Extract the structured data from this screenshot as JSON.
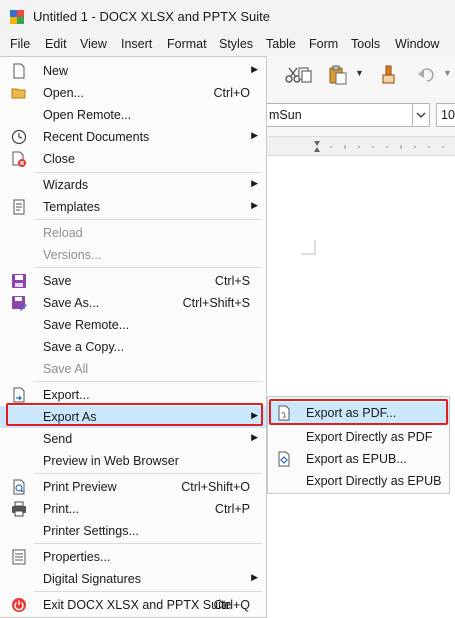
{
  "window": {
    "title": "Untitled 1 - DOCX XLSX and PPTX Suite"
  },
  "menubar": {
    "items": [
      "File",
      "Edit",
      "View",
      "Insert",
      "Format",
      "Styles",
      "Table",
      "Form",
      "Tools",
      "Window"
    ]
  },
  "toolbar": {
    "font_name": "mSun",
    "font_size": "10"
  },
  "file_menu": {
    "items": [
      {
        "label": "New",
        "shortcut": "",
        "submenu": true,
        "icon": "new-document-icon"
      },
      {
        "label": "Open...",
        "shortcut": "Ctrl+O",
        "icon": "folder-open-icon"
      },
      {
        "label": "Open Remote...",
        "shortcut": ""
      },
      {
        "label": "Recent Documents",
        "shortcut": "",
        "submenu": true,
        "icon": "recent-clock-icon"
      },
      {
        "label": "Close",
        "shortcut": "",
        "icon": "close-document-icon"
      },
      {
        "label": "Wizards",
        "shortcut": "",
        "submenu": true
      },
      {
        "label": "Templates",
        "shortcut": "",
        "submenu": true,
        "icon": "templates-icon"
      },
      {
        "label": "Reload",
        "shortcut": "",
        "disabled": true
      },
      {
        "label": "Versions...",
        "shortcut": "",
        "disabled": true
      },
      {
        "label": "Save",
        "shortcut": "Ctrl+S",
        "icon": "save-icon"
      },
      {
        "label": "Save As...",
        "shortcut": "Ctrl+Shift+S",
        "icon": "save-as-icon"
      },
      {
        "label": "Save Remote...",
        "shortcut": ""
      },
      {
        "label": "Save a Copy...",
        "shortcut": ""
      },
      {
        "label": "Save All",
        "shortcut": "",
        "disabled": true
      },
      {
        "label": "Export...",
        "shortcut": "",
        "icon": "export-icon"
      },
      {
        "label": "Export As",
        "shortcut": "",
        "submenu": true,
        "active": true
      },
      {
        "label": "Send",
        "shortcut": "",
        "submenu": true
      },
      {
        "label": "Preview in Web Browser",
        "shortcut": ""
      },
      {
        "label": "Print Preview",
        "shortcut": "Ctrl+Shift+O",
        "icon": "print-preview-icon"
      },
      {
        "label": "Print...",
        "shortcut": "Ctrl+P",
        "icon": "printer-icon"
      },
      {
        "label": "Printer Settings...",
        "shortcut": ""
      },
      {
        "label": "Properties...",
        "shortcut": "",
        "icon": "properties-icon"
      },
      {
        "label": "Digital Signatures",
        "shortcut": "",
        "submenu": true
      },
      {
        "label": "Exit DOCX XLSX and PPTX Suite",
        "shortcut": "Ctrl+Q",
        "icon": "power-exit-icon"
      }
    ]
  },
  "export_as_submenu": {
    "items": [
      {
        "label": "Export as PDF...",
        "icon": "pdf-export-icon",
        "active": true
      },
      {
        "label": "Export Directly as PDF",
        "icon": ""
      },
      {
        "label": "Export as EPUB...",
        "icon": "epub-export-icon"
      },
      {
        "label": "Export Directly as EPUB",
        "icon": ""
      }
    ]
  },
  "colors": {
    "highlight": "#cce8ff",
    "annotation_border": "#e01e1e",
    "menu_bg": "#fbfbfb",
    "disabled_text": "#8f8f8f"
  }
}
